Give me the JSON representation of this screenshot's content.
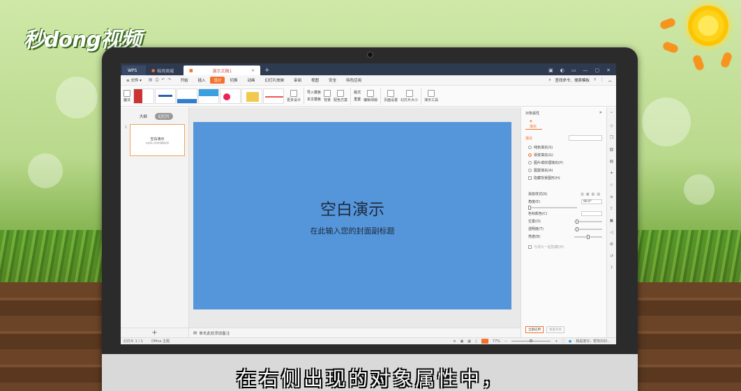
{
  "watermark": {
    "logo": "秒dong视频"
  },
  "tabbar": {
    "wps": "WPS",
    "store": "稻壳商城",
    "doc": "演示文稿1",
    "add": "+"
  },
  "menu": {
    "file": "文件",
    "items": [
      "开始",
      "插入",
      "设计",
      "切换",
      "动画",
      "幻灯片放映",
      "审阅",
      "视图",
      "安全",
      "特色应用"
    ],
    "active": "设计",
    "search": "查找命令、搜索模板"
  },
  "ribbon": {
    "beautify": "魔法",
    "more_design": "更多设计",
    "import_template": "导入模板",
    "text_template": "本文模板",
    "background": "背景",
    "color_scheme": "配色方案",
    "layout": "版式",
    "reset": "重置",
    "edit_master": "编辑母版",
    "page_setup": "页面设置",
    "slide_size": "幻灯片大小",
    "presenter_tools": "演示工具"
  },
  "left_pane": {
    "tab_outline": "大纲",
    "tab_slides": "幻灯片",
    "slide_number": "1",
    "thumb_title": "空白演示",
    "thumb_subtitle": "在此输入您的封面副标题",
    "add": "+"
  },
  "slide": {
    "title": "空白演示",
    "subtitle": "在此输入您的封面副标题"
  },
  "notes": {
    "placeholder": "单击此处添加备注"
  },
  "object_props": {
    "header": "对象属性",
    "tab_fill": "填充",
    "section": "填充",
    "options": [
      "纯色填充(S)",
      "渐变填充(G)",
      "图片或纹理填充(P)",
      "图案填充(A)",
      "隐藏背景图形(H)"
    ],
    "selected": "渐变填充(G)",
    "gradient_style": "渐变样式(R)",
    "angle_label": "角度(E)",
    "angle_value": "90.0°",
    "stop_color": "色标颜色(C)",
    "position": "位置(O)",
    "transparency": "透明度(T)",
    "brightness": "亮度(B)",
    "hide_bg_note": "与母片一起隐藏(M)",
    "apply_all": "全部应用",
    "reset_bg": "重置背景"
  },
  "statusbar": {
    "slide_info": "幻灯片 1 / 1",
    "theme": "Office 主题",
    "zoom": "77%",
    "assistant": "我是度仔，帮你抖抖..."
  },
  "caption": "在右侧出现的对象属性中，",
  "colors": {
    "accent": "#f5722b",
    "slide_bg": "#5596db",
    "titlebar": "#2d3a4f"
  }
}
